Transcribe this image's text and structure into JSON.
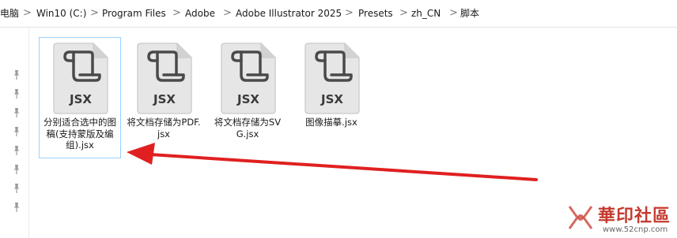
{
  "breadcrumb": {
    "items": [
      "电脑",
      "Win10 (C:)",
      "Program Files",
      "Adobe",
      "Adobe Illustrator 2025",
      "Presets",
      "zh_CN",
      "脚本"
    ],
    "separator": ">"
  },
  "nav_pane": {
    "pin_icon": "pin-icon",
    "pin_count": 8
  },
  "files": [
    {
      "icon_text": "JSX",
      "name": "分别适合选中的图稿(支持蒙版及编组).jsx",
      "selected": true
    },
    {
      "icon_text": "JSX",
      "name": "将文档存储为PDF.jsx",
      "selected": false
    },
    {
      "icon_text": "JSX",
      "name": "将文档存储为SVG.jsx",
      "selected": false
    },
    {
      "icon_text": "JSX",
      "name": "图像描摹.jsx",
      "selected": false
    }
  ],
  "annotation": {
    "arrow_color": "#e02020"
  },
  "watermark": {
    "title": "華印社區",
    "url": "www.52cnp.com",
    "color": "#c53a2f"
  },
  "colors": {
    "selection_border": "#99d1ff",
    "icon_fill": "#e6e6e6",
    "icon_stroke": "#4a4a4a"
  }
}
